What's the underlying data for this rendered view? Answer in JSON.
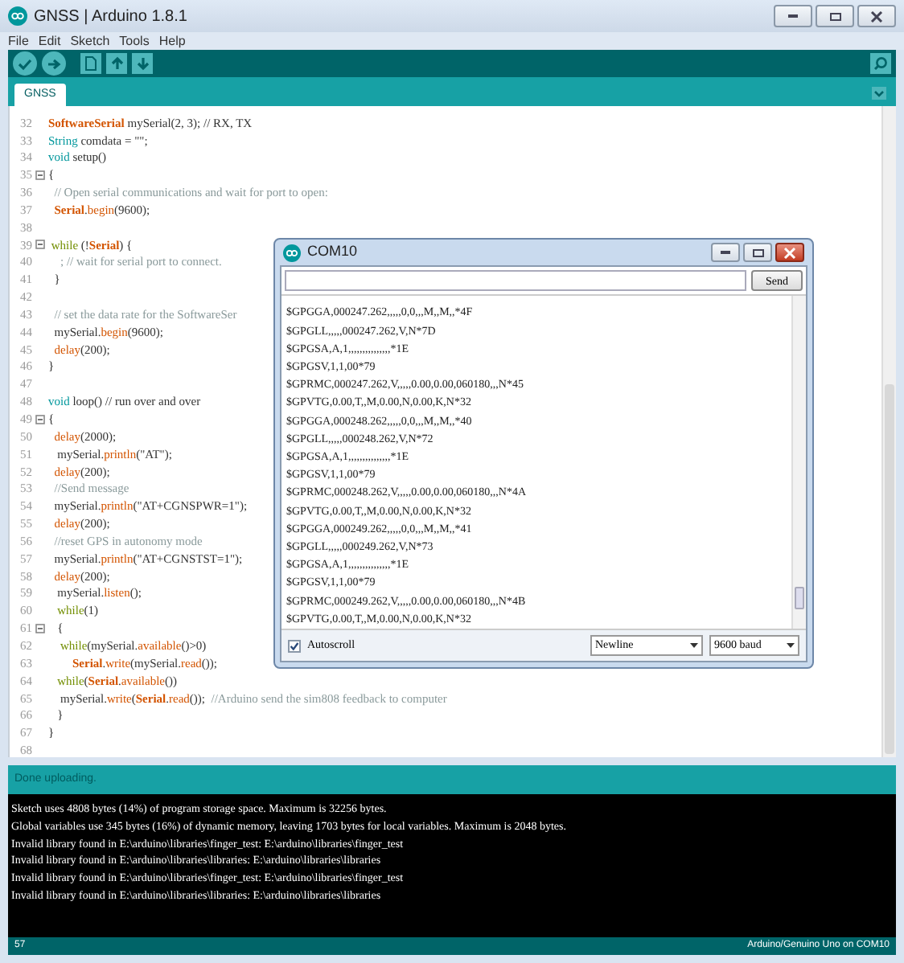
{
  "window": {
    "title": "GNSS | Arduino 1.8.1"
  },
  "menu": [
    "File",
    "Edit",
    "Sketch",
    "Tools",
    "Help"
  ],
  "tabs": [
    {
      "label": "GNSS",
      "selected": true
    }
  ],
  "editor": {
    "lines": [
      {
        "number": "32",
        "tokens": [
          {
            "kind": "class",
            "text": "SoftwareSerial"
          },
          {
            "kind": "plain",
            "text": " mySerial(2, 3); // RX, TX"
          }
        ]
      },
      {
        "number": "33",
        "tokens": [
          {
            "kind": "keyword",
            "text": "String"
          },
          {
            "kind": "plain",
            "text": " comdata = \"\";"
          }
        ]
      },
      {
        "number": "34",
        "tokens": [
          {
            "kind": "keyword",
            "text": "void"
          },
          {
            "kind": "plain",
            "text": " setup()"
          }
        ]
      },
      {
        "number": "35",
        "fold": true,
        "tokens": [
          {
            "kind": "plain",
            "text": "{"
          }
        ]
      },
      {
        "number": "36",
        "tokens": [
          {
            "kind": "comment",
            "text": "  // Open serial communications and wait for port to open:"
          }
        ]
      },
      {
        "number": "37",
        "tokens": [
          {
            "kind": "class",
            "text": "  Serial"
          },
          {
            "kind": "plain",
            "text": "."
          },
          {
            "kind": "function",
            "text": "begin"
          },
          {
            "kind": "plain",
            "text": "(9600);"
          }
        ]
      },
      {
        "number": "38"
      },
      {
        "number": "39",
        "fold": true,
        "tokens": [
          {
            "kind": "control",
            "text": " while"
          },
          {
            "kind": "plain",
            "text": " (!"
          },
          {
            "kind": "class",
            "text": "Serial"
          },
          {
            "kind": "plain",
            "text": ") {"
          }
        ]
      },
      {
        "number": "40",
        "tokens": [
          {
            "kind": "comment",
            "text": "    ; // wait for serial port to connect."
          }
        ]
      },
      {
        "number": "41",
        "tokens": [
          {
            "kind": "plain",
            "text": "  }"
          }
        ]
      },
      {
        "number": "42"
      },
      {
        "number": "43",
        "tokens": [
          {
            "kind": "comment",
            "text": "  // set the data rate for the SoftwareSer"
          }
        ]
      },
      {
        "number": "44",
        "tokens": [
          {
            "kind": "plain",
            "text": "  mySerial."
          },
          {
            "kind": "function",
            "text": "begin"
          },
          {
            "kind": "plain",
            "text": "(9600);"
          }
        ]
      },
      {
        "number": "45",
        "tokens": [
          {
            "kind": "function",
            "text": "  delay"
          },
          {
            "kind": "plain",
            "text": "(200);"
          }
        ]
      },
      {
        "number": "46",
        "tokens": [
          {
            "kind": "plain",
            "text": "}"
          }
        ]
      },
      {
        "number": "47"
      },
      {
        "number": "48",
        "tokens": [
          {
            "kind": "keyword",
            "text": "void"
          },
          {
            "kind": "plain",
            "text": " loop() // run over and over"
          }
        ]
      },
      {
        "number": "49",
        "fold": true,
        "tokens": [
          {
            "kind": "plain",
            "text": "{"
          }
        ]
      },
      {
        "number": "50",
        "tokens": [
          {
            "kind": "function",
            "text": "  delay"
          },
          {
            "kind": "plain",
            "text": "(2000);"
          }
        ]
      },
      {
        "number": "51",
        "tokens": [
          {
            "kind": "plain",
            "text": "   mySerial."
          },
          {
            "kind": "function",
            "text": "println"
          },
          {
            "kind": "string",
            "text": "(\"AT\");"
          }
        ]
      },
      {
        "number": "52",
        "tokens": [
          {
            "kind": "function",
            "text": "  delay"
          },
          {
            "kind": "plain",
            "text": "(200);"
          }
        ]
      },
      {
        "number": "53",
        "tokens": [
          {
            "kind": "comment",
            "text": "  //Send message"
          }
        ]
      },
      {
        "number": "54",
        "tokens": [
          {
            "kind": "plain",
            "text": "  mySerial."
          },
          {
            "kind": "function",
            "text": "println"
          },
          {
            "kind": "string",
            "text": "(\"AT+CGNSPWR=1\");"
          }
        ]
      },
      {
        "number": "55",
        "tokens": [
          {
            "kind": "function",
            "text": "  delay"
          },
          {
            "kind": "plain",
            "text": "(200);"
          }
        ]
      },
      {
        "number": "56",
        "tokens": [
          {
            "kind": "comment",
            "text": "  //reset GPS in autonomy mode"
          }
        ]
      },
      {
        "number": "57",
        "tokens": [
          {
            "kind": "plain",
            "text": "  mySerial."
          },
          {
            "kind": "function",
            "text": "println"
          },
          {
            "kind": "string",
            "text": "(\"AT+CGNSTST=1\");"
          }
        ]
      },
      {
        "number": "58",
        "tokens": [
          {
            "kind": "function",
            "text": "  delay"
          },
          {
            "kind": "plain",
            "text": "(200);"
          }
        ]
      },
      {
        "number": "59",
        "tokens": [
          {
            "kind": "plain",
            "text": "   mySerial."
          },
          {
            "kind": "function",
            "text": "listen"
          },
          {
            "kind": "plain",
            "text": "();"
          }
        ]
      },
      {
        "number": "60",
        "tokens": [
          {
            "kind": "control",
            "text": "   while"
          },
          {
            "kind": "plain",
            "text": "(1)"
          }
        ]
      },
      {
        "number": "61",
        "fold": true,
        "tokens": [
          {
            "kind": "plain",
            "text": "   {"
          }
        ]
      },
      {
        "number": "62",
        "tokens": [
          {
            "kind": "control",
            "text": "    while"
          },
          {
            "kind": "plain",
            "text": "(mySerial."
          },
          {
            "kind": "function",
            "text": "available"
          },
          {
            "kind": "plain",
            "text": "()>0)"
          }
        ]
      },
      {
        "number": "63",
        "tokens": [
          {
            "kind": "class",
            "text": "        Serial"
          },
          {
            "kind": "plain",
            "text": "."
          },
          {
            "kind": "function",
            "text": "write"
          },
          {
            "kind": "plain",
            "text": "(mySerial."
          },
          {
            "kind": "function",
            "text": "read"
          },
          {
            "kind": "plain",
            "text": "());"
          }
        ]
      },
      {
        "number": "64",
        "tokens": [
          {
            "kind": "control",
            "text": "   while"
          },
          {
            "kind": "plain",
            "text": "("
          },
          {
            "kind": "class",
            "text": "Serial"
          },
          {
            "kind": "plain",
            "text": "."
          },
          {
            "kind": "function",
            "text": "available"
          },
          {
            "kind": "plain",
            "text": "())"
          }
        ]
      },
      {
        "number": "65",
        "tokens": [
          {
            "kind": "plain",
            "text": "    mySerial."
          },
          {
            "kind": "function",
            "text": "write"
          },
          {
            "kind": "plain",
            "text": "("
          },
          {
            "kind": "class",
            "text": "Serial"
          },
          {
            "kind": "plain",
            "text": "."
          },
          {
            "kind": "function",
            "text": "read"
          },
          {
            "kind": "plain",
            "text": "());  "
          },
          {
            "kind": "comment",
            "text": "//Arduino send the sim808 feedback to computer"
          }
        ]
      },
      {
        "number": "66",
        "tokens": [
          {
            "kind": "plain",
            "text": "   }"
          }
        ]
      },
      {
        "number": "67",
        "tokens": [
          {
            "kind": "plain",
            "text": "}"
          }
        ]
      },
      {
        "number": "68"
      }
    ]
  },
  "serial_monitor": {
    "title": "COM10",
    "send_button": "Send",
    "lines": [
      "$GPGGA,000247.262,,,,,0,0,,,M,,M,,*4F",
      "$GPGLL,,,,,000247.262,V,N*7D",
      "$GPGSA,A,1,,,,,,,,,,,,,,,*1E",
      "$GPGSV,1,1,00*79",
      "$GPRMC,000247.262,V,,,,,0.00,0.00,060180,,,N*45",
      "$GPVTG,0.00,T,,M,0.00,N,0.00,K,N*32",
      "$GPGGA,000248.262,,,,,0,0,,,M,,M,,*40",
      "$GPGLL,,,,,000248.262,V,N*72",
      "$GPGSA,A,1,,,,,,,,,,,,,,,*1E",
      "$GPGSV,1,1,00*79",
      "$GPRMC,000248.262,V,,,,,0.00,0.00,060180,,,N*4A",
      "$GPVTG,0.00,T,,M,0.00,N,0.00,K,N*32",
      "$GPGGA,000249.262,,,,,0,0,,,M,,M,,*41",
      "$GPGLL,,,,,000249.262,V,N*73",
      "$GPGSA,A,1,,,,,,,,,,,,,,,*1E",
      "$GPGSV,1,1,00*79",
      "$GPRMC,000249.262,V,,,,,0.00,0.00,060180,,,N*4B",
      "$GPVTG,0.00,T,,M,0.00,N,0.00,K,N*32"
    ],
    "autoscroll": {
      "label": "Autoscroll",
      "checked": true
    },
    "line_ending": "Newline",
    "baud": "9600 baud"
  },
  "status": "Done uploading.",
  "console": [
    "Sketch uses 4808 bytes (14%) of program storage space. Maximum is 32256 bytes.",
    "Global variables use 345 bytes (16%) of dynamic memory, leaving 1703 bytes for local variables. Maximum is 2048 bytes.",
    "Invalid library found in E:\\arduino\\libraries\\finger_test: E:\\arduino\\libraries\\finger_test",
    "Invalid library found in E:\\arduino\\libraries\\libraries: E:\\arduino\\libraries\\libraries",
    "Invalid library found in E:\\arduino\\libraries\\finger_test: E:\\arduino\\libraries\\finger_test",
    "Invalid library found in E:\\arduino\\libraries\\libraries: E:\\arduino\\libraries\\libraries"
  ],
  "status_bar": {
    "line": "57",
    "board": "Arduino/Genuino Uno on COM10"
  }
}
